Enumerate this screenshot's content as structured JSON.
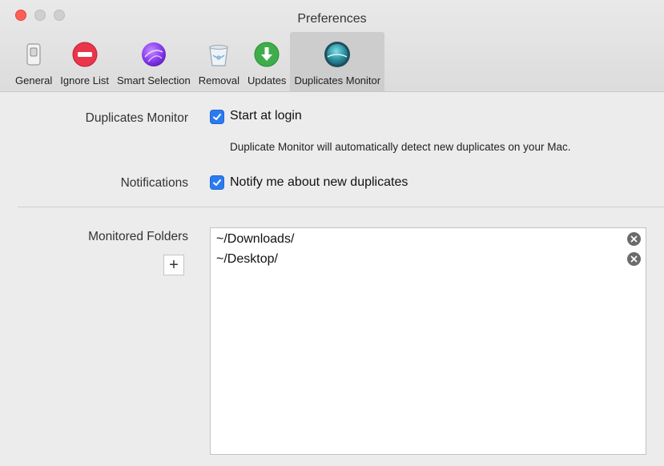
{
  "window": {
    "title": "Preferences"
  },
  "toolbar": {
    "tabs": [
      {
        "label": "General",
        "icon": "switch-icon"
      },
      {
        "label": "Ignore List",
        "icon": "no-entry-icon"
      },
      {
        "label": "Smart Selection",
        "icon": "smart-orb-icon"
      },
      {
        "label": "Removal",
        "icon": "trash-icon"
      },
      {
        "label": "Updates",
        "icon": "download-arrow-icon"
      },
      {
        "label": "Duplicates Monitor",
        "icon": "monitor-globe-icon"
      }
    ],
    "active_tab": "Duplicates Monitor"
  },
  "settings": {
    "duplicates_monitor": {
      "label": "Duplicates Monitor",
      "checkbox_label": "Start at login",
      "checked": true,
      "description": "Duplicate Monitor will automatically detect new duplicates on your Mac."
    },
    "notifications": {
      "label": "Notifications",
      "checkbox_label": "Notify me about new duplicates",
      "checked": true
    },
    "monitored_folders": {
      "label": "Monitored Folders",
      "add_symbol": "+",
      "folders": [
        "~/Downloads/",
        "~/Desktop/"
      ]
    }
  },
  "colors": {
    "accent": "#2b7bf0",
    "close_button": "#ff5f57",
    "active_tab_bg": "#cdcdcd"
  }
}
